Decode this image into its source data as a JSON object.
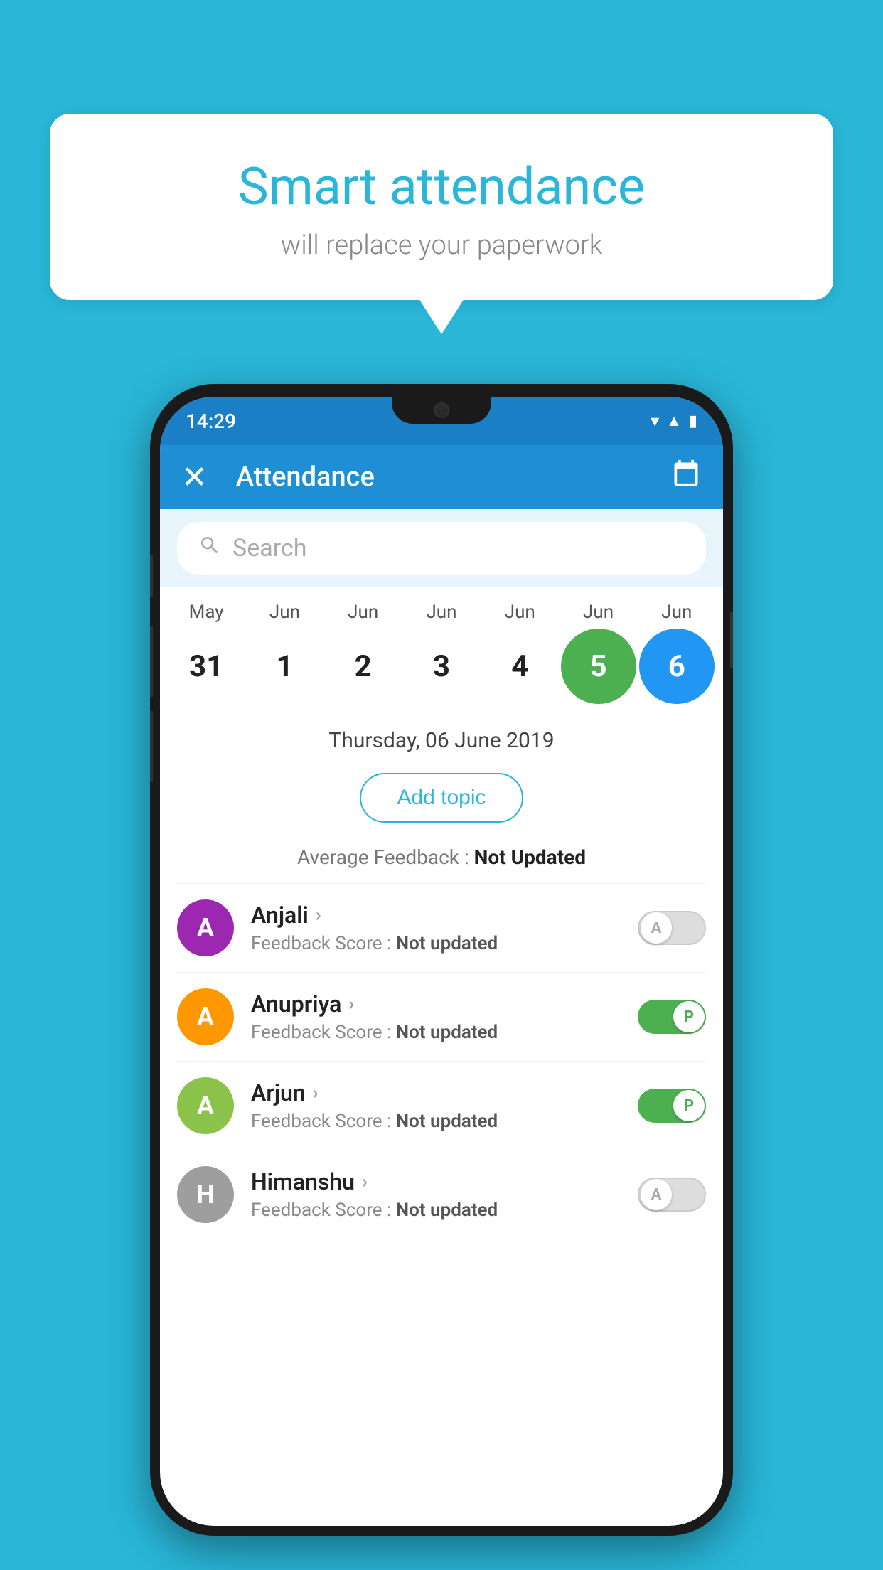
{
  "background_color": "#29b6d8",
  "speech_bubble": {
    "title": "Smart attendance",
    "subtitle": "will replace your paperwork"
  },
  "phone": {
    "status_bar": {
      "time": "14:29"
    },
    "app_bar": {
      "title": "Attendance",
      "close_label": "✕",
      "calendar_icon": "📅"
    },
    "search": {
      "placeholder": "Search"
    },
    "calendar": {
      "months": [
        "May",
        "Jun",
        "Jun",
        "Jun",
        "Jun",
        "Jun",
        "Jun"
      ],
      "dates": [
        "31",
        "1",
        "2",
        "3",
        "4",
        "5",
        "6"
      ],
      "today_index": 5,
      "selected_index": 6
    },
    "selected_date_label": "Thursday, 06 June 2019",
    "add_topic_label": "Add topic",
    "avg_feedback_label": "Average Feedback : ",
    "avg_feedback_value": "Not Updated",
    "students": [
      {
        "name": "Anjali",
        "avatar_letter": "A",
        "avatar_color": "#9c27b0",
        "feedback_label": "Feedback Score : ",
        "feedback_value": "Not updated",
        "toggle_state": "off",
        "toggle_letter": "A"
      },
      {
        "name": "Anupriya",
        "avatar_letter": "A",
        "avatar_color": "#ff9800",
        "feedback_label": "Feedback Score : ",
        "feedback_value": "Not updated",
        "toggle_state": "on",
        "toggle_letter": "P"
      },
      {
        "name": "Arjun",
        "avatar_letter": "A",
        "avatar_color": "#8bc34a",
        "feedback_label": "Feedback Score : ",
        "feedback_value": "Not updated",
        "toggle_state": "on",
        "toggle_letter": "P"
      },
      {
        "name": "Himanshu",
        "avatar_letter": "H",
        "avatar_color": "#9e9e9e",
        "feedback_label": "Feedback Score : ",
        "feedback_value": "Not updated",
        "toggle_state": "off",
        "toggle_letter": "A"
      }
    ]
  }
}
